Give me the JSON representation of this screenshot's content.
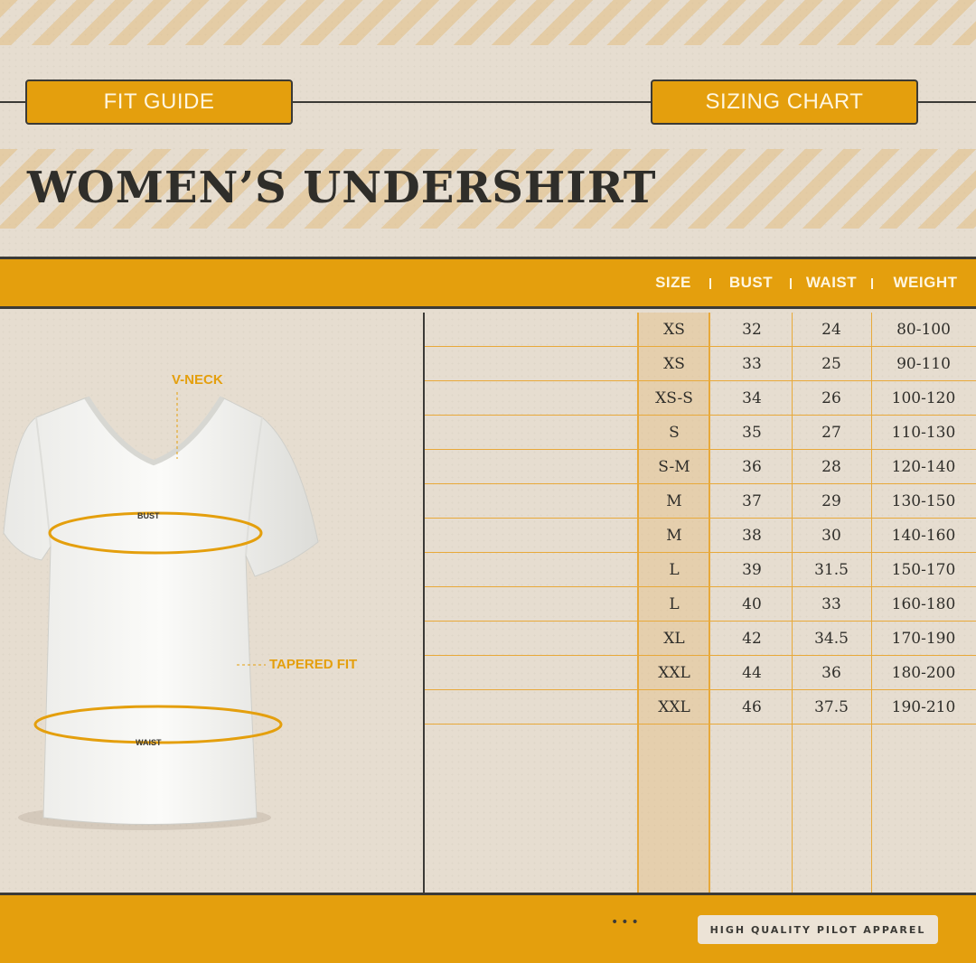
{
  "tags": {
    "fit_guide": "FIT GUIDE",
    "sizing_chart": "SIZING CHART"
  },
  "title": "WOMEN’S UNDERSHIRT",
  "illustration": {
    "labels": {
      "v_neck": "V-NECK",
      "bust": "BUST",
      "tapered_fit": "TAPERED FIT",
      "waist": "WAIST"
    },
    "shirt_color": "#f7f7f5",
    "accent_color": "#e49f0d"
  },
  "table": {
    "headers": [
      "SIZE",
      "BUST",
      "WAIST",
      "WEIGHT"
    ],
    "rows": [
      [
        "XS",
        "32",
        "24",
        "80-100"
      ],
      [
        "XS",
        "33",
        "25",
        "90-110"
      ],
      [
        "XS-S",
        "34",
        "26",
        "100-120"
      ],
      [
        "S",
        "35",
        "27",
        "110-130"
      ],
      [
        "S-M",
        "36",
        "28",
        "120-140"
      ],
      [
        "M",
        "37",
        "29",
        "130-150"
      ],
      [
        "M",
        "38",
        "30",
        "140-160"
      ],
      [
        "L",
        "39",
        "31.5",
        "150-170"
      ],
      [
        "L",
        "40",
        "33",
        "160-180"
      ],
      [
        "XL",
        "42",
        "34.5",
        "170-190"
      ],
      [
        "XXL",
        "44",
        "36",
        "180-200"
      ],
      [
        "XXL",
        "46",
        "37.5",
        "190-210"
      ]
    ]
  },
  "footer": {
    "dots": "•••",
    "badge": "HIGH QUALITY PILOT APPAREL"
  },
  "colors": {
    "accent": "#e49f0d",
    "background": "#e6ddd0",
    "ink": "#2f2e2a"
  }
}
